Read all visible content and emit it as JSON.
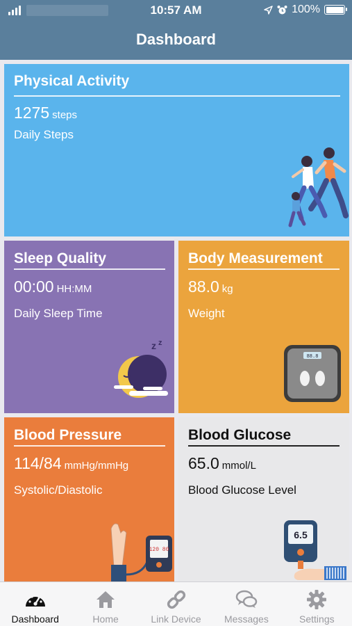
{
  "status_bar": {
    "time": "10:57 AM",
    "battery": "100%"
  },
  "header": {
    "title": "Dashboard"
  },
  "cards": {
    "activity": {
      "title": "Physical Activity",
      "value": "1275",
      "unit": "steps",
      "label": "Daily Steps",
      "color": "#5ab4ec"
    },
    "sleep": {
      "title": "Sleep Quality",
      "value": "00:00",
      "unit": "HH:MM",
      "label": "Daily Sleep Time",
      "color": "#8873b3"
    },
    "body": {
      "title": "Body Measurement",
      "value": "88.0",
      "unit": "kg",
      "label": "Weight",
      "color": "#eba43d"
    },
    "bp": {
      "title": "Blood Pressure",
      "value": "114/84",
      "unit": "mmHg/mmHg",
      "label": "Systolic/Diastolic",
      "color": "#ea7d3c"
    },
    "glucose": {
      "title": "Blood Glucose",
      "value": "65.0",
      "unit": "mmol/L",
      "label": "Blood Glucose Level",
      "color": "#e8e8ea"
    }
  },
  "illustrations": {
    "scale_display": "88.8",
    "bp_monitor_display": "120 80",
    "glucometer_display": "6.5"
  },
  "tabs": [
    {
      "label": "Dashboard",
      "icon": "speedometer-icon",
      "active": true
    },
    {
      "label": "Home",
      "icon": "home-icon",
      "active": false
    },
    {
      "label": "Link Device",
      "icon": "link-icon",
      "active": false
    },
    {
      "label": "Messages",
      "icon": "chat-bubbles-icon",
      "active": false
    },
    {
      "label": "Settings",
      "icon": "gear-icon",
      "active": false
    }
  ]
}
